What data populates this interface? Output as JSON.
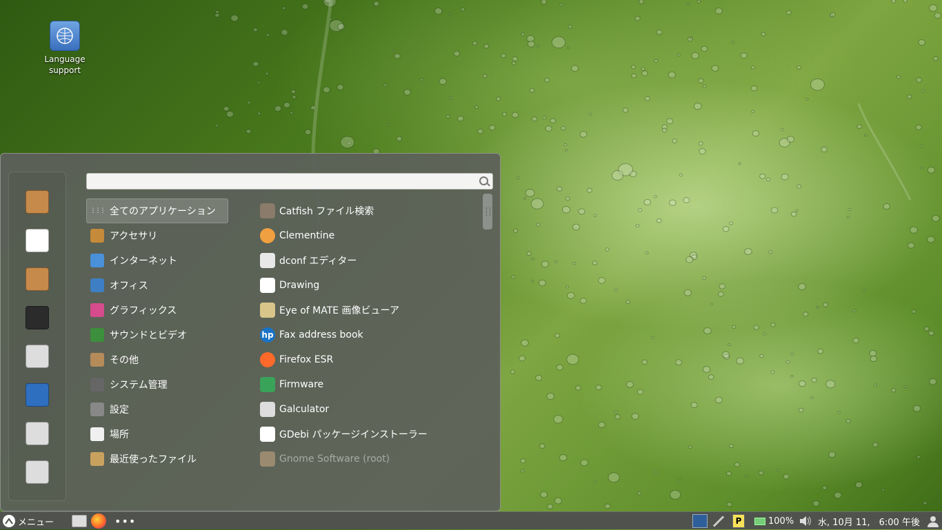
{
  "desktop": {
    "icon_label": "Language support"
  },
  "menu": {
    "search": {
      "placeholder": ""
    },
    "categories": [
      {
        "label": "全てのアプリケーション",
        "icon": "grid-icon",
        "color": "#e6e6e6"
      },
      {
        "label": "アクセサリ",
        "icon": "accessories-icon",
        "color": "#c58a3a"
      },
      {
        "label": "インターネット",
        "icon": "internet-icon",
        "color": "#4a90d9"
      },
      {
        "label": "オフィス",
        "icon": "office-icon",
        "color": "#3d7fc2"
      },
      {
        "label": "グラフィックス",
        "icon": "graphics-icon",
        "color": "#d64b8c"
      },
      {
        "label": "サウンドとビデオ",
        "icon": "sound-video-icon",
        "color": "#3c8f3c"
      },
      {
        "label": "その他",
        "icon": "other-icon",
        "color": "#b58b5a"
      },
      {
        "label": "システム管理",
        "icon": "system-admin-icon",
        "color": "#666666"
      },
      {
        "label": "設定",
        "icon": "settings-icon",
        "color": "#888888"
      },
      {
        "label": "場所",
        "icon": "folder-icon",
        "color": "#f0f0f0"
      },
      {
        "label": "最近使ったファイル",
        "icon": "recent-files-icon",
        "color": "#c9a15e"
      }
    ],
    "apps": [
      {
        "label": "Catfish ファイル検索",
        "icon": "catfish-icon",
        "color": "#8a7b6a",
        "dim": false
      },
      {
        "label": "Clementine",
        "icon": "clementine-icon",
        "color": "#f0a040",
        "dim": false
      },
      {
        "label": "dconf エディター",
        "icon": "dconf-icon",
        "color": "#e8e8e8",
        "dim": false
      },
      {
        "label": "Drawing",
        "icon": "drawing-icon",
        "color": "#ffffff",
        "dim": false
      },
      {
        "label": "Eye of MATE 画像ビューア",
        "icon": "eye-of-mate-icon",
        "color": "#d9c58a",
        "dim": false
      },
      {
        "label": "Fax address book",
        "icon": "hp-icon",
        "color": "#1a73c6",
        "dim": false
      },
      {
        "label": "Firefox ESR",
        "icon": "firefox-icon",
        "color": "#ff6a2a",
        "dim": false
      },
      {
        "label": "Firmware",
        "icon": "firmware-icon",
        "color": "#3aa35a",
        "dim": false
      },
      {
        "label": "Galculator",
        "icon": "calculator-icon",
        "color": "#dddddd",
        "dim": false
      },
      {
        "label": "GDebi パッケージインストーラー",
        "icon": "debian-icon",
        "color": "#ffffff",
        "dim": false
      },
      {
        "label": "Gnome Software (root)",
        "icon": "gnome-software-icon",
        "color": "#9a8a70",
        "dim": true
      }
    ]
  },
  "favorites": [
    {
      "name": "package-icon",
      "color": "#c68a4a"
    },
    {
      "name": "store-icon",
      "color": "#ffffff"
    },
    {
      "name": "package-install-icon",
      "color": "#c68a4a"
    },
    {
      "name": "terminal-icon",
      "color": "#2b2b2b"
    },
    {
      "name": "settings-sliders-icon",
      "color": "#dddddd"
    },
    {
      "name": "lock-screen-icon",
      "color": "#2f6fc0"
    },
    {
      "name": "logout-icon",
      "color": "#dddddd"
    },
    {
      "name": "power-icon",
      "color": "#dddddd"
    }
  ],
  "panel": {
    "menu_label": "メニュー",
    "battery": "100%",
    "clock": "水, 10月 11,　6:00 午後"
  }
}
